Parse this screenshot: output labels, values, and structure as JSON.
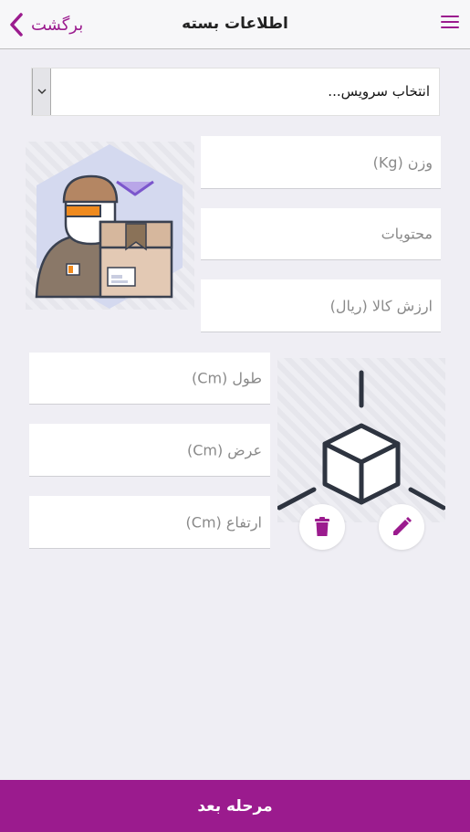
{
  "header": {
    "back_label": "برگشت",
    "title": "اطلاعات بسته"
  },
  "form": {
    "service_select": {
      "placeholder": "انتخاب سرویس..."
    },
    "weight": {
      "placeholder": "وزن (Kg)"
    },
    "contents": {
      "placeholder": "محتویات"
    },
    "value": {
      "placeholder": "ارزش کالا (ریال)"
    },
    "length": {
      "placeholder": "طول (Cm)"
    },
    "width": {
      "placeholder": "عرض (Cm)"
    },
    "height": {
      "placeholder": "ارتفاع (Cm)"
    }
  },
  "footer": {
    "next_label": "مرحله بعد"
  },
  "icons": [
    "chevron-left-icon",
    "hamburger-menu-icon",
    "chevron-down-icon",
    "delivery-person-illustration",
    "box-dimensions-illustration",
    "trash-icon",
    "pencil-icon"
  ],
  "colors": {
    "accent": "#9b1b8e",
    "background": "#efeef4",
    "header": "#f7f7f9",
    "illustration_blue": "#d4d9ef",
    "illustration_dark": "#3a4150"
  }
}
